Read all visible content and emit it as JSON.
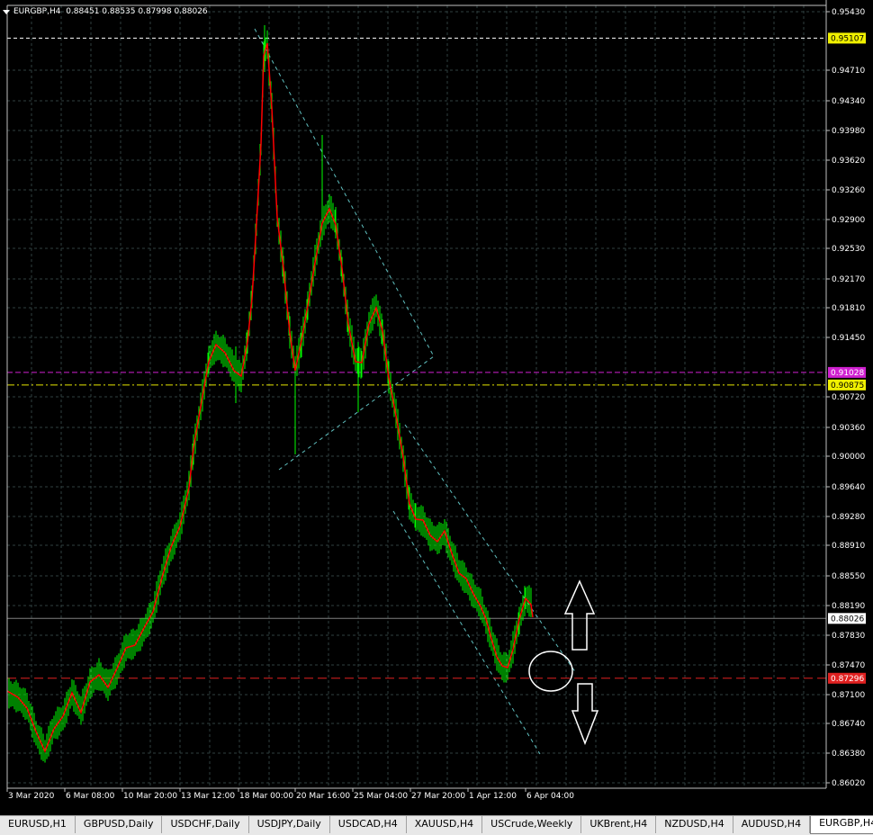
{
  "chart": {
    "symbol_header": "EURGBP,H4",
    "ohlc_text": "0.88451 0.88535 0.87998 0.88026",
    "colors": {
      "background": "#000000",
      "grid": "#2f3f3f",
      "candles": "#00ff00",
      "ma": "#ff0000",
      "trendline": "#5fbfbf",
      "magenta_line": "#d020d0",
      "yellow_line": "#e6e600",
      "red_line": "#e02020",
      "white": "#ffffff"
    }
  },
  "price_axis": {
    "labels": [
      "0.95430",
      "0.94710",
      "0.94340",
      "0.93980",
      "0.93620",
      "0.93260",
      "0.92900",
      "0.92530",
      "0.92170",
      "0.91810",
      "0.91450",
      "0.90720",
      "0.90360",
      "0.90000",
      "0.89640",
      "0.89280",
      "0.88910",
      "0.88550",
      "0.88190",
      "0.87830",
      "0.87470",
      "0.87100",
      "0.86740",
      "0.86380",
      "0.86020"
    ]
  },
  "time_axis": {
    "labels": [
      "3 Mar 2020",
      "6 Mar 08:00",
      "10 Mar 20:00",
      "13 Mar 12:00",
      "18 Mar 00:00",
      "20 Mar 16:00",
      "25 Mar 04:00",
      "27 Mar 20:00",
      "1 Apr 12:00",
      "6 Apr 04:00"
    ]
  },
  "levels": {
    "top": "0.95107",
    "magenta": "0.91028",
    "yellow": "0.90875",
    "current": "0.88026",
    "red": "0.87296"
  },
  "icons": {
    "up": "arrow-up-icon",
    "down": "arrow-down-icon",
    "circle": "circle-marker-icon"
  },
  "tabs": [
    "EURUSD,H1",
    "GBPUSD,Daily",
    "USDCHF,Daily",
    "USDJPY,Daily",
    "USDCAD,H4",
    "XAUUSD,H4",
    "USCrude,Weekly",
    "UKBrent,H4",
    "NZDUSD,H4",
    "AUDUSD,H4",
    "EURGBP,H4"
  ],
  "active_tab": 10
}
